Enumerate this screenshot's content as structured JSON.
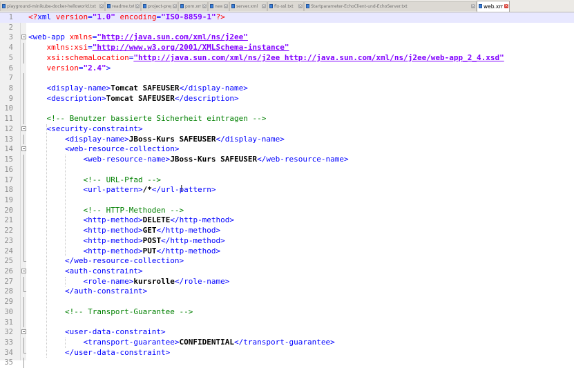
{
  "tabs": [
    {
      "label": "playground-minikube-docker-helloworld.txt",
      "active": false
    },
    {
      "label": "readme.txt",
      "active": false
    },
    {
      "label": "project-prep.txt",
      "active": false
    },
    {
      "label": "pom.xml",
      "active": false
    },
    {
      "label": "new 1",
      "active": false
    },
    {
      "label": "server.xml",
      "active": false
    },
    {
      "label": "fix-ssl.txt",
      "active": false
    },
    {
      "label": "Startparameter-EchoClient-und-EchoServer.txt",
      "active": false
    },
    {
      "label": "web.xml",
      "active": true
    }
  ],
  "editor": {
    "language": "XML",
    "lines": [
      {
        "n": "1",
        "code": [
          {
            "t": "pi",
            "s": "<?"
          },
          {
            "t": "tag",
            "s": "xml "
          },
          {
            "t": "attr",
            "s": "version"
          },
          {
            "t": "tag",
            "s": "="
          },
          {
            "t": "val",
            "s": "\"1.0\""
          },
          {
            "t": "tag",
            "s": " "
          },
          {
            "t": "attr",
            "s": "encoding"
          },
          {
            "t": "tag",
            "s": "="
          },
          {
            "t": "val",
            "s": "\"ISO-8859-1\""
          },
          {
            "t": "pi",
            "s": "?>"
          }
        ]
      },
      {
        "n": "2",
        "code": []
      },
      {
        "n": "3",
        "code": [
          {
            "t": "tag",
            "s": "<web-app "
          },
          {
            "t": "attr",
            "s": "xmlns"
          },
          {
            "t": "tag",
            "s": "="
          },
          {
            "t": "url",
            "s": "\"http://java.sun.com/xml/ns/j2ee\""
          }
        ]
      },
      {
        "n": "4",
        "code": [
          {
            "t": "tag",
            "s": "    "
          },
          {
            "t": "attr",
            "s": "xmlns:xsi"
          },
          {
            "t": "tag",
            "s": "="
          },
          {
            "t": "url",
            "s": "\"http://www.w3.org/2001/XMLSchema-instance\""
          }
        ]
      },
      {
        "n": "5",
        "code": [
          {
            "t": "tag",
            "s": "    "
          },
          {
            "t": "attr",
            "s": "xsi:schemaLocation"
          },
          {
            "t": "tag",
            "s": "="
          },
          {
            "t": "url",
            "s": "\"http://java.sun.com/xml/ns/j2ee http://java.sun.com/xml/ns/j2ee/web-app_2_4.xsd\""
          }
        ]
      },
      {
        "n": "6",
        "code": [
          {
            "t": "tag",
            "s": "    "
          },
          {
            "t": "attr",
            "s": "version"
          },
          {
            "t": "tag",
            "s": "="
          },
          {
            "t": "val",
            "s": "\"2.4\""
          },
          {
            "t": "tag",
            "s": ">"
          }
        ]
      },
      {
        "n": "7",
        "code": []
      },
      {
        "n": "8",
        "code": [
          {
            "t": "tag",
            "s": "    <display-name>"
          },
          {
            "t": "txt",
            "s": "Tomcat SAFEUSER"
          },
          {
            "t": "tag",
            "s": "</display-name>"
          }
        ]
      },
      {
        "n": "9",
        "code": [
          {
            "t": "tag",
            "s": "    <description>"
          },
          {
            "t": "txt",
            "s": "Tomcat SAFEUSER"
          },
          {
            "t": "tag",
            "s": "</description>"
          }
        ]
      },
      {
        "n": "10",
        "code": []
      },
      {
        "n": "11",
        "code": [
          {
            "t": "cmt",
            "s": "    <!-- Benutzer bassierte Sicherheit eintragen -->"
          }
        ]
      },
      {
        "n": "12",
        "code": [
          {
            "t": "tag",
            "s": "    <security-constraint>"
          }
        ]
      },
      {
        "n": "13",
        "code": [
          {
            "t": "tag",
            "s": "        <display-name>"
          },
          {
            "t": "txt",
            "s": "JBoss-Kurs SAFEUSER"
          },
          {
            "t": "tag",
            "s": "</display-name>"
          }
        ]
      },
      {
        "n": "14",
        "code": [
          {
            "t": "tag",
            "s": "        <web-resource-collection>"
          }
        ]
      },
      {
        "n": "15",
        "code": [
          {
            "t": "tag",
            "s": "            <web-resource-name>"
          },
          {
            "t": "txt",
            "s": "JBoss-Kurs SAFEUSER"
          },
          {
            "t": "tag",
            "s": "</web-resource-name>"
          }
        ]
      },
      {
        "n": "16",
        "code": []
      },
      {
        "n": "17",
        "code": [
          {
            "t": "cmt",
            "s": "            <!-- URL-Pfad -->"
          }
        ]
      },
      {
        "n": "18",
        "code": [
          {
            "t": "tag",
            "s": "            <url-pattern>"
          },
          {
            "t": "txt",
            "s": "/*"
          },
          {
            "t": "tag",
            "s": "</url-pattern>"
          }
        ]
      },
      {
        "n": "19",
        "code": []
      },
      {
        "n": "20",
        "code": [
          {
            "t": "cmt",
            "s": "            <!-- HTTP-Methoden -->"
          }
        ]
      },
      {
        "n": "21",
        "code": [
          {
            "t": "tag",
            "s": "            <http-method>"
          },
          {
            "t": "txt",
            "s": "DELETE"
          },
          {
            "t": "tag",
            "s": "</http-method>"
          }
        ]
      },
      {
        "n": "22",
        "code": [
          {
            "t": "tag",
            "s": "            <http-method>"
          },
          {
            "t": "txt",
            "s": "GET"
          },
          {
            "t": "tag",
            "s": "</http-method>"
          }
        ]
      },
      {
        "n": "23",
        "code": [
          {
            "t": "tag",
            "s": "            <http-method>"
          },
          {
            "t": "txt",
            "s": "POST"
          },
          {
            "t": "tag",
            "s": "</http-method>"
          }
        ]
      },
      {
        "n": "24",
        "code": [
          {
            "t": "tag",
            "s": "            <http-method>"
          },
          {
            "t": "txt",
            "s": "PUT"
          },
          {
            "t": "tag",
            "s": "</http-method>"
          }
        ]
      },
      {
        "n": "25",
        "code": [
          {
            "t": "tag",
            "s": "        </web-resource-collection>"
          }
        ]
      },
      {
        "n": "26",
        "code": [
          {
            "t": "tag",
            "s": "        <auth-constraint>"
          }
        ]
      },
      {
        "n": "27",
        "code": [
          {
            "t": "tag",
            "s": "            <role-name>"
          },
          {
            "t": "txt",
            "s": "kursrolle"
          },
          {
            "t": "tag",
            "s": "</role-name>"
          }
        ]
      },
      {
        "n": "28",
        "code": [
          {
            "t": "tag",
            "s": "        </auth-constraint>"
          }
        ]
      },
      {
        "n": "29",
        "code": []
      },
      {
        "n": "30",
        "code": [
          {
            "t": "cmt",
            "s": "        <!-- Transport-Guarantee -->"
          }
        ]
      },
      {
        "n": "31",
        "code": []
      },
      {
        "n": "32",
        "code": [
          {
            "t": "tag",
            "s": "        <user-data-constraint>"
          }
        ]
      },
      {
        "n": "33",
        "code": [
          {
            "t": "tag",
            "s": "            <transport-guarantee>"
          },
          {
            "t": "txt",
            "s": "CONFIDENTIAL"
          },
          {
            "t": "tag",
            "s": "</transport-guarantee>"
          }
        ]
      },
      {
        "n": "34",
        "code": [
          {
            "t": "tag",
            "s": "        </user-data-constraint>"
          }
        ]
      },
      {
        "n": "35",
        "code": []
      }
    ],
    "fold_open_lines": [
      "3",
      "12",
      "14",
      "26",
      "32"
    ],
    "fold_end_lines": [
      "25",
      "28",
      "34"
    ],
    "fold_body_lines": [
      "4",
      "5",
      "7",
      "8",
      "9",
      "10",
      "11",
      "13",
      "15",
      "16",
      "17",
      "18",
      "19",
      "20",
      "21",
      "22",
      "23",
      "24",
      "27",
      "29",
      "30",
      "31",
      "33",
      "35"
    ],
    "current_line": "1"
  },
  "colors": {
    "tag": "#0000ff",
    "attribute": "#ff0000",
    "value": "#8000ff",
    "comment": "#008000",
    "text": "#000000",
    "gutter": "#f0f0f0",
    "active_tab_close": "#d8433a"
  }
}
